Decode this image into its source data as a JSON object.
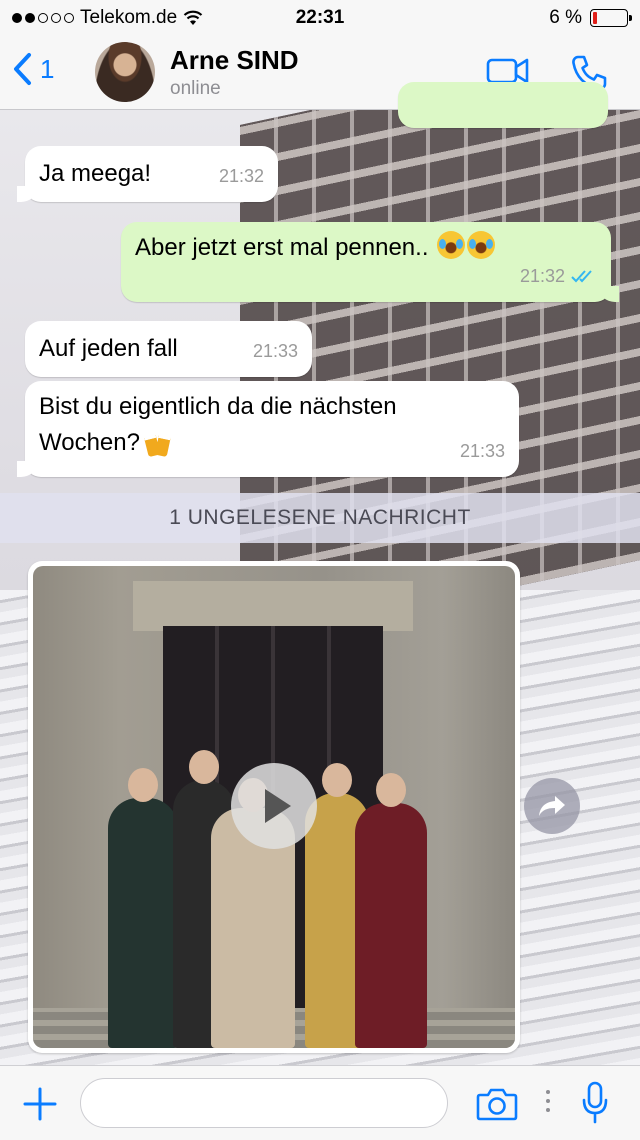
{
  "statusbar": {
    "carrier": "Telekom.de",
    "time": "22:31",
    "battery_percent": "6 %",
    "battery_level": 0.06,
    "signal_bars_filled": 2,
    "signal_bars_total": 5
  },
  "header": {
    "back_count": "1",
    "contact_name": "Arne SIND",
    "contact_status": "online",
    "accent_color": "#0a7cff"
  },
  "messages": [
    {
      "direction": "incoming",
      "text": "Ja meega!",
      "time": "21:32"
    },
    {
      "direction": "outgoing",
      "text": "Aber jetzt erst mal pennen..",
      "emoji": [
        "face-with-tears-of-joy",
        "face-with-tears-of-joy"
      ],
      "time": "21:32",
      "read": true
    },
    {
      "direction": "incoming",
      "text": "Auf jeden fall",
      "time": "21:33"
    },
    {
      "direction": "incoming",
      "text_line1": "Bist du eigentlich da die nächsten",
      "text_line2": "Wochen?",
      "emoji": [
        "clinking-beer-mugs"
      ],
      "time": "21:33"
    }
  ],
  "unread_banner": "1 UNGELESENE NACHRICHT",
  "video_message": {
    "type": "video",
    "play_icon": "play-icon",
    "forward_icon": "forward-arrow-icon"
  },
  "input": {
    "placeholder": "",
    "value": ""
  },
  "colors": {
    "incoming_bubble": "#ffffff",
    "outgoing_bubble": "#dcf8c6",
    "read_ticks": "#34b7f1",
    "battery_low": "#e0201a"
  }
}
